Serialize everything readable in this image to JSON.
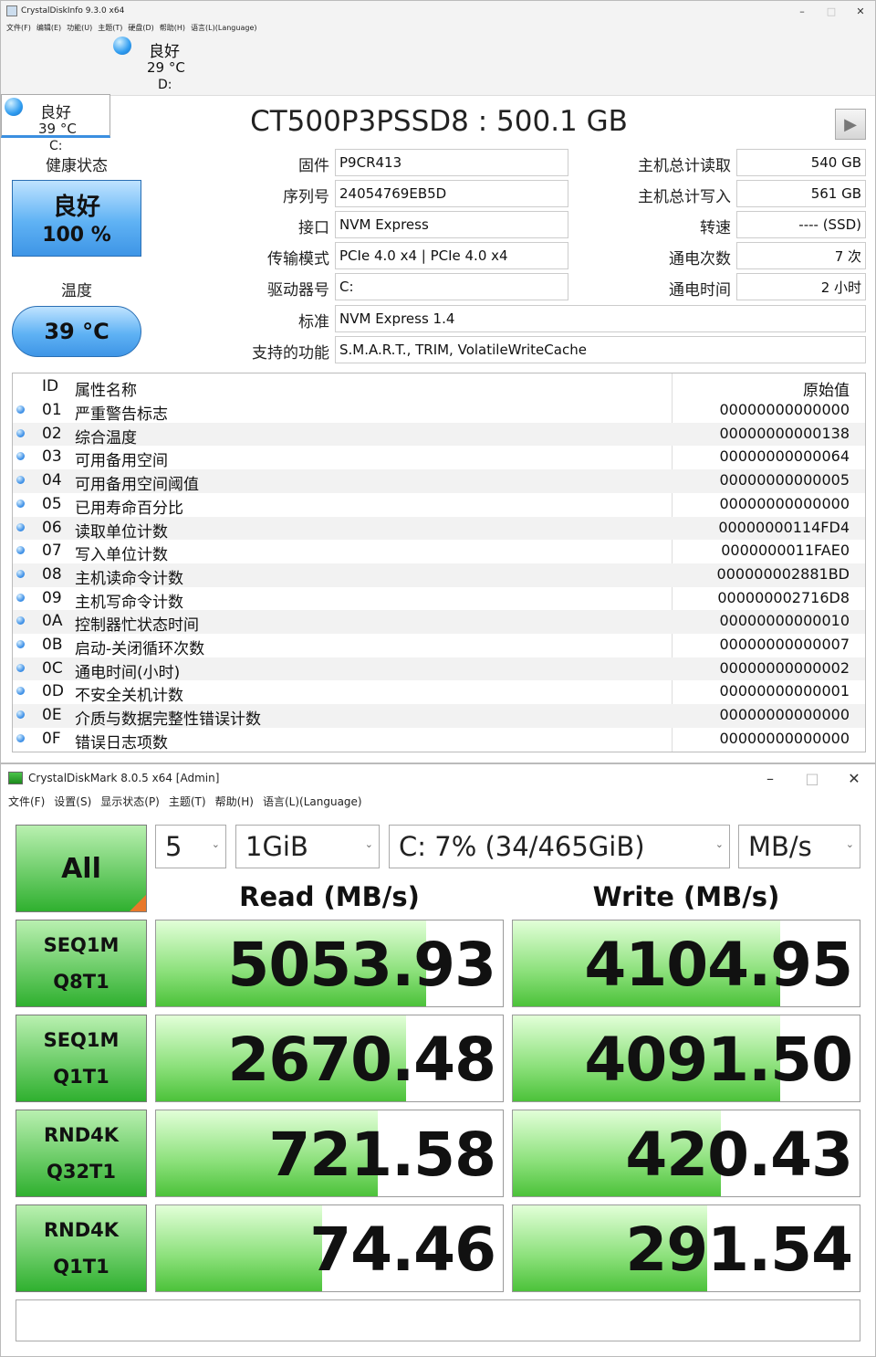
{
  "cdi": {
    "title": "CrystalDiskInfo 9.3.0 x64",
    "menu": [
      "文件(F)",
      "编辑(E)",
      "功能(U)",
      "主题(T)",
      "硬盘(D)",
      "帮助(H)",
      "语言(L)(Language)"
    ],
    "drives": [
      {
        "status": "良好",
        "temp": "39 °C",
        "letter": "C:"
      },
      {
        "status": "良好",
        "temp": "29 °C",
        "letter": "D:"
      }
    ],
    "model": "CT500P3PSSD8 : 500.1 GB",
    "health_label": "健康状态",
    "health_status": "良好",
    "health_percent": "100 %",
    "temp_label": "温度",
    "temp_value": "39 °C",
    "info_left": [
      {
        "label": "固件",
        "value": "P9CR413"
      },
      {
        "label": "序列号",
        "value": "24054769EB5D"
      },
      {
        "label": "接口",
        "value": "NVM Express"
      },
      {
        "label": "传输模式",
        "value": "PCIe 4.0 x4 | PCIe 4.0 x4"
      },
      {
        "label": "驱动器号",
        "value": "C:"
      },
      {
        "label": "标准",
        "value": "NVM Express 1.4"
      },
      {
        "label": "支持的功能",
        "value": "S.M.A.R.T., TRIM, VolatileWriteCache"
      }
    ],
    "info_right": [
      {
        "label": "主机总计读取",
        "value": "540 GB"
      },
      {
        "label": "主机总计写入",
        "value": "561 GB"
      },
      {
        "label": "转速",
        "value": "---- (SSD)"
      },
      {
        "label": "通电次数",
        "value": "7 次"
      },
      {
        "label": "通电时间",
        "value": "2 小时"
      }
    ],
    "smart_headers": {
      "id": "ID",
      "name": "属性名称",
      "raw": "原始值"
    },
    "smart": [
      {
        "id": "01",
        "name": "严重警告标志",
        "raw": "00000000000000"
      },
      {
        "id": "02",
        "name": "综合温度",
        "raw": "00000000000138"
      },
      {
        "id": "03",
        "name": "可用备用空间",
        "raw": "00000000000064"
      },
      {
        "id": "04",
        "name": "可用备用空间阈值",
        "raw": "00000000000005"
      },
      {
        "id": "05",
        "name": "已用寿命百分比",
        "raw": "00000000000000"
      },
      {
        "id": "06",
        "name": "读取单位计数",
        "raw": "00000000114FD4"
      },
      {
        "id": "07",
        "name": "写入单位计数",
        "raw": "0000000011FAE0"
      },
      {
        "id": "08",
        "name": "主机读命令计数",
        "raw": "000000002881BD"
      },
      {
        "id": "09",
        "name": "主机写命令计数",
        "raw": "000000002716D8"
      },
      {
        "id": "0A",
        "name": "控制器忙状态时间",
        "raw": "00000000000010"
      },
      {
        "id": "0B",
        "name": "启动-关闭循环次数",
        "raw": "00000000000007"
      },
      {
        "id": "0C",
        "name": "通电时间(小时)",
        "raw": "00000000000002"
      },
      {
        "id": "0D",
        "name": "不安全关机计数",
        "raw": "00000000000001"
      },
      {
        "id": "0E",
        "name": "介质与数据完整性错误计数",
        "raw": "00000000000000"
      },
      {
        "id": "0F",
        "name": "错误日志项数",
        "raw": "00000000000000"
      }
    ]
  },
  "cdm": {
    "title": "CrystalDiskMark 8.0.5 x64 [Admin]",
    "menu": [
      "文件(F)",
      "设置(S)",
      "显示状态(P)",
      "主题(T)",
      "帮助(H)",
      "语言(L)(Language)"
    ],
    "all_label": "All",
    "count": "5",
    "size": "1GiB",
    "drive": "C: 7% (34/465GiB)",
    "unit": "MB/s",
    "read_header": "Read (MB/s)",
    "write_header": "Write (MB/s)",
    "tests": [
      {
        "l1": "SEQ1M",
        "l2": "Q8T1",
        "read": "5053.93",
        "write": "4104.95",
        "read_fill": 0.78,
        "write_fill": 0.77
      },
      {
        "l1": "SEQ1M",
        "l2": "Q1T1",
        "read": "2670.48",
        "write": "4091.50",
        "read_fill": 0.72,
        "write_fill": 0.77
      },
      {
        "l1": "RND4K",
        "l2": "Q32T1",
        "read": "721.58",
        "write": "420.43",
        "read_fill": 0.64,
        "write_fill": 0.6
      },
      {
        "l1": "RND4K",
        "l2": "Q1T1",
        "read": "74.46",
        "write": "291.54",
        "read_fill": 0.48,
        "write_fill": 0.56
      }
    ],
    "comment": ""
  }
}
